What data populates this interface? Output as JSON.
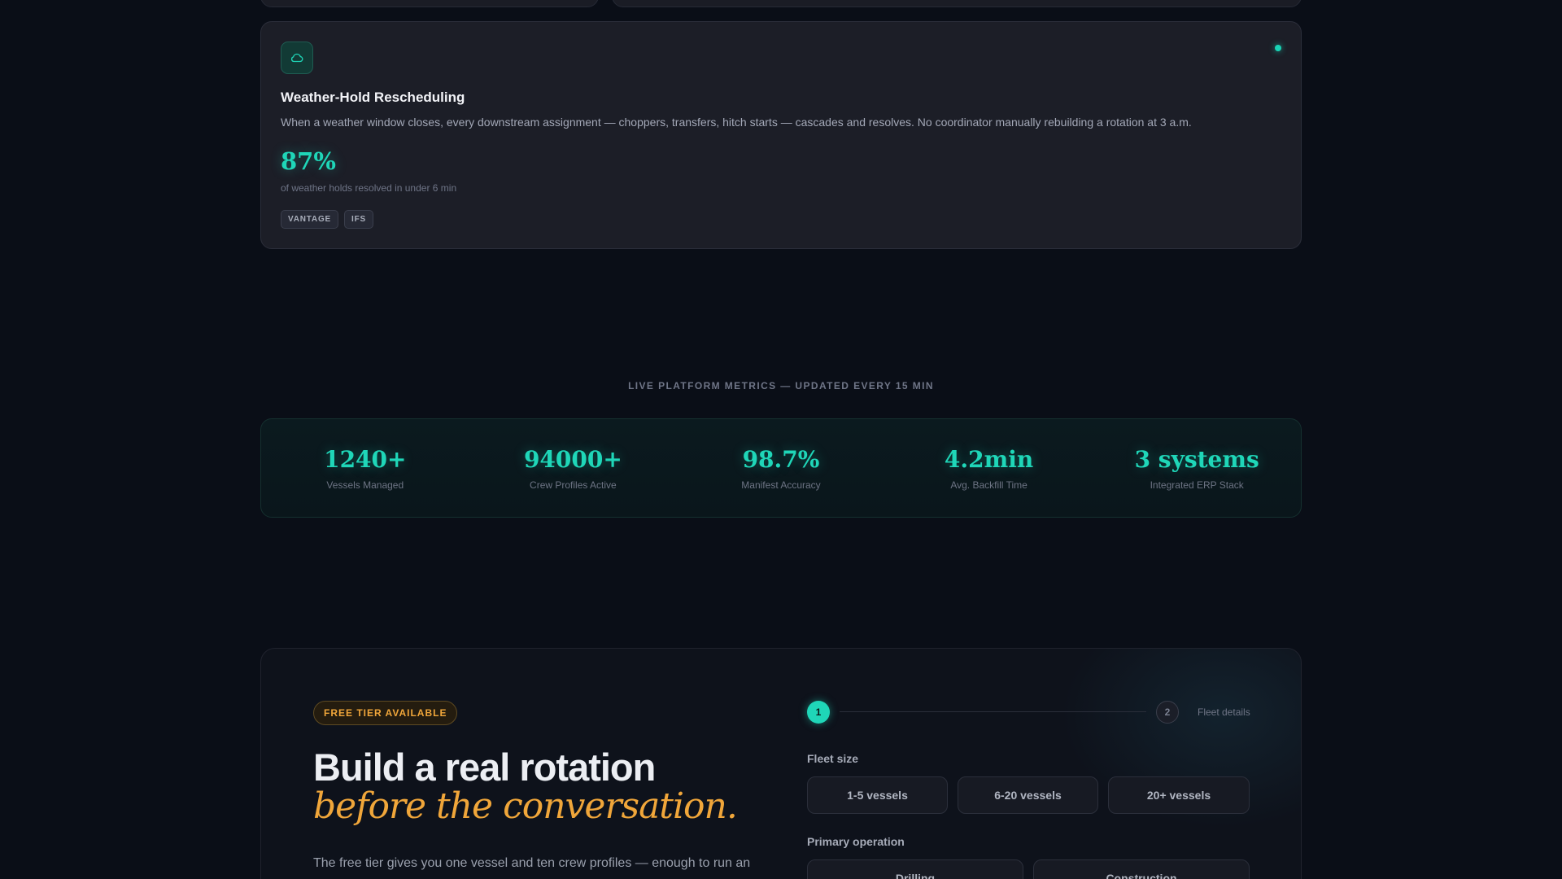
{
  "feature": {
    "title": "Weather-Hold Rescheduling",
    "description": "When a weather window closes, every downstream assignment — choppers, transfers, hitch starts — cascades and resolves. No coordinator manually rebuilding a rotation at 3 a.m.",
    "stat_value": "87%",
    "stat_label": "of weather holds resolved in under 6 min",
    "tags": [
      "VANTAGE",
      "IFS"
    ],
    "icon": "cloud-icon"
  },
  "metrics": {
    "heading": "LIVE PLATFORM METRICS — UPDATED EVERY 15 MIN",
    "items": [
      {
        "value": "1240+",
        "label": "Vessels Managed"
      },
      {
        "value": "94000+",
        "label": "Crew Profiles Active"
      },
      {
        "value": "98.7%",
        "label": "Manifest Accuracy"
      },
      {
        "value": "4.2min",
        "label": "Avg. Backfill Time"
      },
      {
        "value": "3 systems",
        "label": "Integrated ERP Stack"
      }
    ]
  },
  "signup": {
    "badge": "FREE TIER AVAILABLE",
    "headline": "Build a real rotation",
    "headline_accent": "before the conversation.",
    "description": "The free tier gives you one vessel and ten crew profiles — enough to run an actual hitch rotation and feel the friction disappear before a trial call is even"
  },
  "form": {
    "steps": [
      {
        "number": "1",
        "label": ""
      },
      {
        "number": "2",
        "label": "Fleet details"
      }
    ],
    "fleet_size": {
      "label": "Fleet size",
      "options": [
        "1-5 vessels",
        "6-20 vessels",
        "20+ vessels"
      ]
    },
    "primary_operation": {
      "label": "Primary operation",
      "options": [
        "Drilling",
        "Construction"
      ]
    }
  },
  "colors": {
    "accent_teal": "#1fd6b8",
    "accent_amber": "#f0a63a",
    "background": "#0a0e17"
  }
}
